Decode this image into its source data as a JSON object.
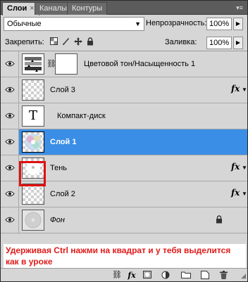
{
  "tabs": [
    {
      "label": "Слои",
      "active": true
    },
    {
      "label": "Каналы",
      "active": false
    },
    {
      "label": "Контуры",
      "active": false
    }
  ],
  "blend_mode": "Обычные",
  "opacity": {
    "label": "Непрозрачность:",
    "value": "100%"
  },
  "lock": {
    "label": "Закрепить:"
  },
  "fill": {
    "label": "Заливка:",
    "value": "100%"
  },
  "layers": [
    {
      "name": "Цветовой тон/Насыщенность 1",
      "type": "adjustment",
      "fx": false,
      "selected": false
    },
    {
      "name": "Слой 3",
      "type": "raster",
      "fx": true,
      "selected": false
    },
    {
      "name": "Компакт-диск",
      "type": "text",
      "fx": false,
      "selected": false
    },
    {
      "name": "Слой 1",
      "type": "raster",
      "fx": false,
      "selected": true
    },
    {
      "name": "Тень",
      "type": "raster",
      "fx": true,
      "selected": false
    },
    {
      "name": "Слой 2",
      "type": "raster",
      "fx": true,
      "selected": false
    },
    {
      "name": "Фон",
      "type": "background",
      "fx": false,
      "selected": false
    }
  ],
  "fx_symbol": "fx",
  "text_layer_glyph": "T",
  "caption": "Удерживая Ctrl нажми на квадрат и у тебя выделится как в уроке",
  "colors": {
    "selection": "#3a8ee6",
    "caption": "#e01a1a",
    "highlight": "#e01010"
  }
}
